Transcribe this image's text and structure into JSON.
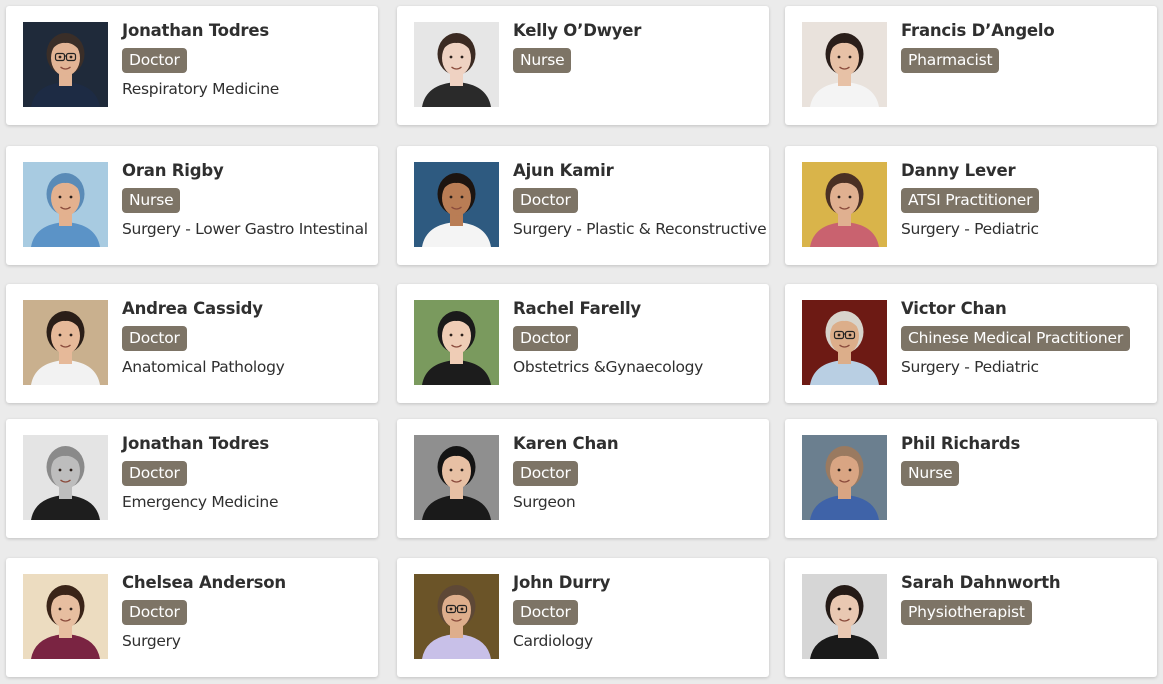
{
  "cards": [
    {
      "name": "Jonathan Todres",
      "role": "Doctor",
      "specialty": "Respiratory Medicine",
      "photo": {
        "bg": "#1f2a3a",
        "skin": "#e2b495",
        "hair": "#3a2e28",
        "shirt": "#1d2b44",
        "glasses": true
      }
    },
    {
      "name": "Kelly O’Dwyer",
      "role": "Nurse",
      "specialty": "",
      "photo": {
        "bg": "#e6e6e6",
        "skin": "#efd2c2",
        "hair": "#3b2a22",
        "shirt": "#2a2a2a",
        "glasses": false
      }
    },
    {
      "name": "Francis D’Angelo",
      "role": "Pharmacist",
      "specialty": "",
      "photo": {
        "bg": "#e9e2dc",
        "skin": "#e7c1a6",
        "hair": "#2a1e1a",
        "shirt": "#f4f4f4",
        "glasses": false
      }
    },
    {
      "name": "Oran Rigby",
      "role": "Nurse",
      "specialty": "Surgery - Lower Gastro Intestinal",
      "photo": {
        "bg": "#a8cbe1",
        "skin": "#e3b18f",
        "hair": "#5a8bb7",
        "shirt": "#5b93c7",
        "glasses": false
      }
    },
    {
      "name": "Ajun Kamir",
      "role": "Doctor",
      "specialty": "Surgery - Plastic & Reconstructive",
      "photo": {
        "bg": "#2e5a80",
        "skin": "#b97d55",
        "hair": "#1c1410",
        "shirt": "#f4f4f4",
        "glasses": false
      }
    },
    {
      "name": "Danny Lever",
      "role": "ATSI Practitioner",
      "specialty": "Surgery - Pediatric",
      "photo": {
        "bg": "#d9b44a",
        "skin": "#e0b090",
        "hair": "#4a3024",
        "shirt": "#c9626f",
        "glasses": false
      }
    },
    {
      "name": "Andrea Cassidy",
      "role": "Doctor",
      "specialty": "Anatomical Pathology",
      "photo": {
        "bg": "#c9b08e",
        "skin": "#e6b999",
        "hair": "#2a1e18",
        "shirt": "#f2f2f2",
        "glasses": false
      }
    },
    {
      "name": "Rachel Farelly",
      "role": "Doctor",
      "specialty": "Obstetrics &Gynaecology",
      "photo": {
        "bg": "#7a9a5e",
        "skin": "#efcdb6",
        "hair": "#1a1a1a",
        "shirt": "#1c1c1c",
        "glasses": false
      }
    },
    {
      "name": "Victor Chan",
      "role": "Chinese Medical Practitioner",
      "specialty": "Surgery - Pediatric",
      "photo": {
        "bg": "#6d1a14",
        "skin": "#dcae8a",
        "hair": "#d8d4cc",
        "shirt": "#b9cfe3",
        "glasses": true
      }
    },
    {
      "name": "Jonathan Todres",
      "role": "Doctor",
      "specialty": "Emergency Medicine",
      "photo": {
        "bg": "#e4e4e4",
        "skin": "#bdbdbd",
        "hair": "#8a8a8a",
        "shirt": "#1e1e1e",
        "glasses": false
      }
    },
    {
      "name": "Karen Chan",
      "role": "Doctor",
      "specialty": "Surgeon",
      "photo": {
        "bg": "#8f8f8f",
        "skin": "#e7c0a4",
        "hair": "#141414",
        "shirt": "#1a1a1a",
        "glasses": false
      }
    },
    {
      "name": "Phil Richards",
      "role": "Nurse",
      "specialty": "",
      "photo": {
        "bg": "#6b7f8f",
        "skin": "#d9a583",
        "hair": "#9a7a60",
        "shirt": "#3f63a8",
        "glasses": false
      }
    },
    {
      "name": "Chelsea Anderson",
      "role": "Doctor",
      "specialty": "Surgery",
      "photo": {
        "bg": "#ecdcc0",
        "skin": "#e7bea0",
        "hair": "#3a2418",
        "shirt": "#7a2442",
        "glasses": false
      }
    },
    {
      "name": "John Durry",
      "role": "Doctor",
      "specialty": "Cardiology",
      "photo": {
        "bg": "#6b5428",
        "skin": "#deae8c",
        "hair": "#5e4836",
        "shirt": "#c8c0e8",
        "glasses": true
      }
    },
    {
      "name": "Sarah Dahnworth",
      "role": "Physiotherapist",
      "specialty": "",
      "photo": {
        "bg": "#d6d6d6",
        "skin": "#e9c8b2",
        "hair": "#241a16",
        "shirt": "#1a1a1a",
        "glasses": false
      }
    }
  ]
}
